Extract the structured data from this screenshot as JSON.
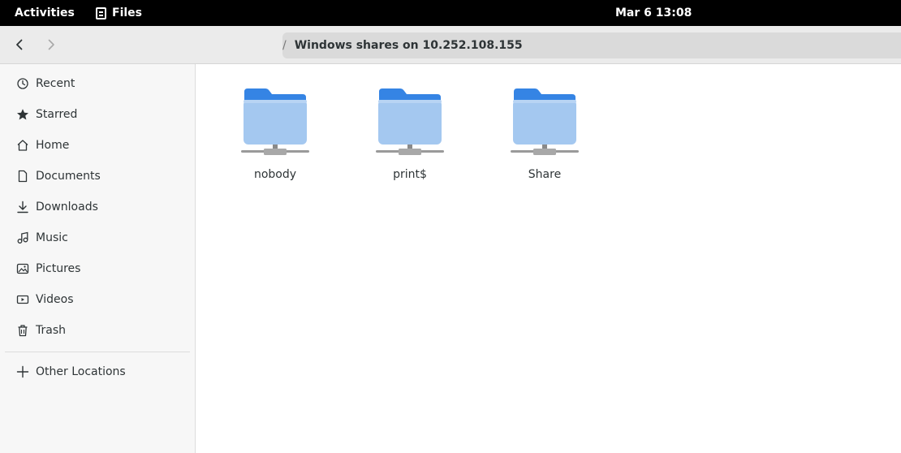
{
  "topbar": {
    "activities": "Activities",
    "app_name": "Files",
    "clock": "Mar 6  13:08"
  },
  "header": {
    "path_separator": "/",
    "location": "Windows shares on 10.252.108.155"
  },
  "sidebar": {
    "items": [
      {
        "label": "Recent",
        "icon": "clock-icon"
      },
      {
        "label": "Starred",
        "icon": "star-icon"
      },
      {
        "label": "Home",
        "icon": "home-icon"
      },
      {
        "label": "Documents",
        "icon": "document-icon"
      },
      {
        "label": "Downloads",
        "icon": "download-icon"
      },
      {
        "label": "Music",
        "icon": "music-icon"
      },
      {
        "label": "Pictures",
        "icon": "picture-icon"
      },
      {
        "label": "Videos",
        "icon": "video-icon"
      },
      {
        "label": "Trash",
        "icon": "trash-icon"
      }
    ],
    "other_locations": {
      "label": "Other Locations",
      "icon": "plus-icon"
    }
  },
  "main": {
    "shares": [
      {
        "label": "nobody",
        "icon": "network-folder-icon"
      },
      {
        "label": "print$",
        "icon": "network-folder-icon"
      },
      {
        "label": "Share",
        "icon": "network-folder-icon"
      }
    ]
  },
  "colors": {
    "folder_back": "#3584e4",
    "folder_front": "#99c1f1",
    "topbar_bg": "#000000",
    "headerbar_bg": "#ebebeb",
    "sidebar_bg": "#f7f7f7"
  }
}
